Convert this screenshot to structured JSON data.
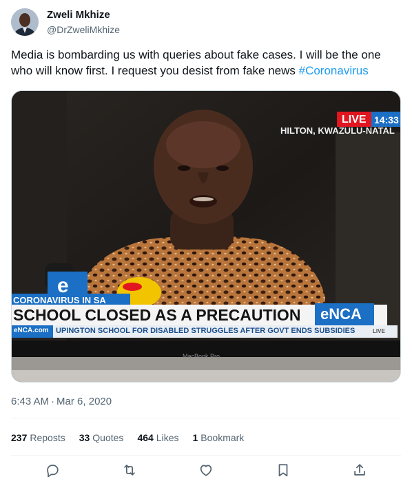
{
  "author": {
    "name": "Zweli Mkhize",
    "handle": "@DrZweliMkhize"
  },
  "tweet": {
    "text": "Media is bombarding us with queries about fake cases. I will be the one who will know first. I request you desist from fake news ",
    "hashtag": "#Coronavirus",
    "time": "6:43 AM",
    "separator": "·",
    "date": "Mar 6, 2020"
  },
  "media": {
    "live_label": "LIVE",
    "live_time": "14:33",
    "location": "HILTON, KWAZULU-NATAL",
    "tag": "CORONAVIRUS IN SA",
    "headline": "SCHOOL CLOSED AS A PRECAUTION",
    "brand": "eNCA",
    "ticker_site": "eNCA.com",
    "ticker_text": "UPINGTON SCHOOL FOR DISABLED STRUGGLES AFTER GOVT ENDS SUBSIDIES",
    "ticker_live": "LIVE",
    "laptop_label": "MacBook Pro",
    "colors": {
      "red": "#e2161f",
      "blue": "#1b6fc4",
      "yellow": "#f2c400"
    }
  },
  "stats": {
    "reposts_count": "237",
    "reposts_label": "Reposts",
    "quotes_count": "33",
    "quotes_label": "Quotes",
    "likes_count": "464",
    "likes_label": "Likes",
    "bookmarks_count": "1",
    "bookmarks_label": "Bookmark"
  },
  "actions": [
    "reply-icon",
    "repost-icon",
    "like-icon",
    "bookmark-icon",
    "share-icon"
  ]
}
